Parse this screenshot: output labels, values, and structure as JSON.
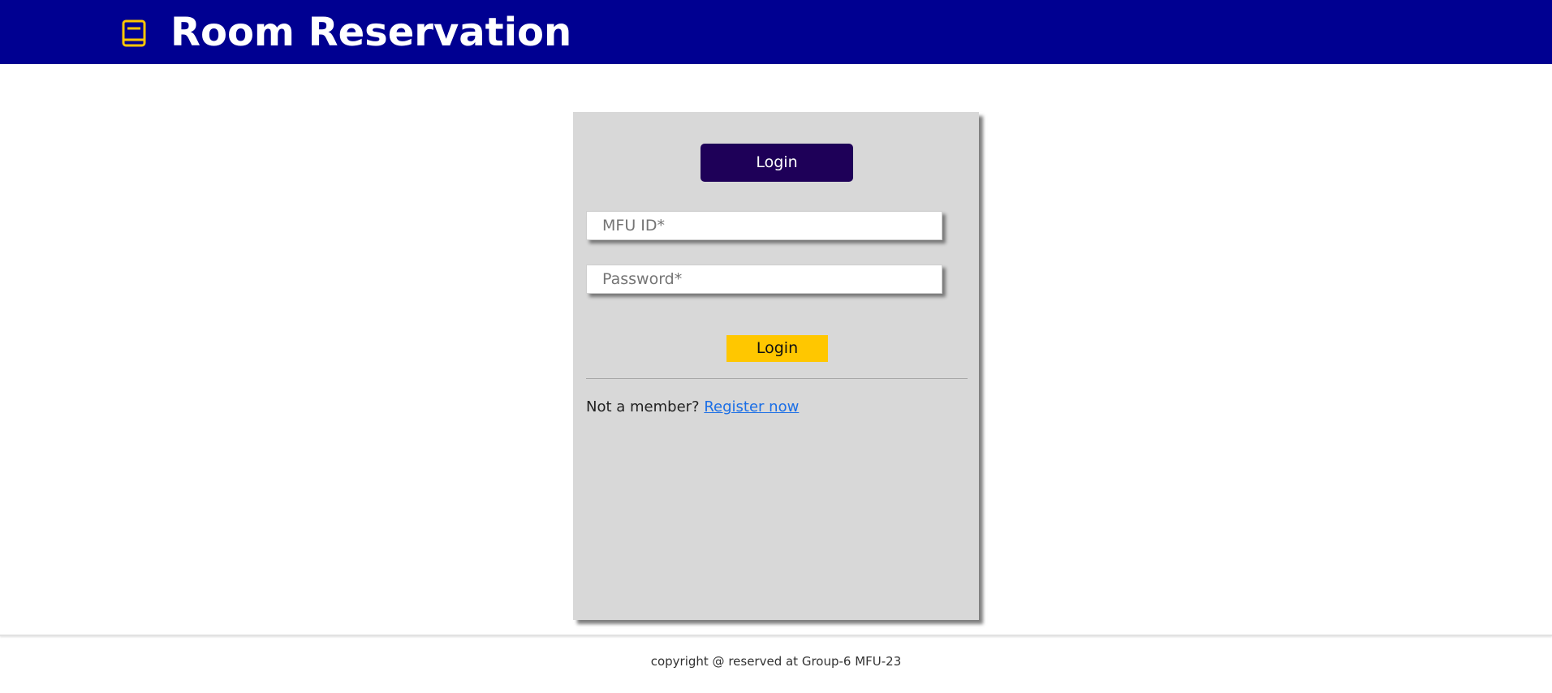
{
  "header": {
    "title": "Room Reservation",
    "icon": "book-icon",
    "background_color": "#000091",
    "icon_color": "#ffc700"
  },
  "login_card": {
    "tab_label": "Login",
    "fields": {
      "mfu_id_placeholder": "MFU ID*",
      "mfu_id_value": "",
      "password_placeholder": "Password*",
      "password_value": ""
    },
    "submit_label": "Login",
    "register_prompt": "Not a member?",
    "register_link": "Register now",
    "colors": {
      "tab_background": "#1e0058",
      "submit_background": "#ffc700",
      "card_background": "#d8d8d8",
      "link": "#1a6ee6"
    }
  },
  "footer": {
    "text": "copyright @ reserved at Group-6 MFU-23"
  }
}
